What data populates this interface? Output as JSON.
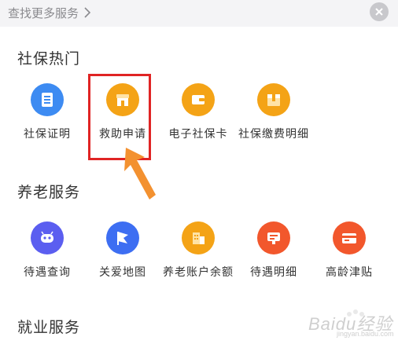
{
  "header": {
    "more_services": "查找更多服务",
    "close_icon": "close-icon"
  },
  "sections": [
    {
      "title": "社保热门",
      "items": [
        {
          "label": "社保证明",
          "icon": "document-icon",
          "color": "#3d8bf2"
        },
        {
          "label": "救助申请",
          "icon": "store-icon",
          "color": "#f4a316"
        },
        {
          "label": "电子社保卡",
          "icon": "wallet-card-icon",
          "color": "#f4a316"
        },
        {
          "label": "社保缴费明细",
          "icon": "package-icon",
          "color": "#f4a316"
        }
      ]
    },
    {
      "title": "养老服务",
      "items": [
        {
          "label": "待遇查询",
          "icon": "robot-face-icon",
          "color": "#5b5ef0"
        },
        {
          "label": "关爱地图",
          "icon": "flag-icon",
          "color": "#3d6ef2"
        },
        {
          "label": "养老账户余额",
          "icon": "building-icon",
          "color": "#f4a316"
        },
        {
          "label": "待遇明细",
          "icon": "screen-icon",
          "color": "#f2572c"
        },
        {
          "label": "高龄津贴",
          "icon": "card-icon",
          "color": "#f2572c"
        }
      ]
    },
    {
      "title": "就业服务",
      "items": []
    }
  ],
  "watermark": {
    "text": "Baidu经验",
    "sub": "jingyan.baidu.com"
  },
  "colors": {
    "highlight": "#e02424",
    "arrow": "#f39130",
    "topbar": "#f4f4f6"
  }
}
